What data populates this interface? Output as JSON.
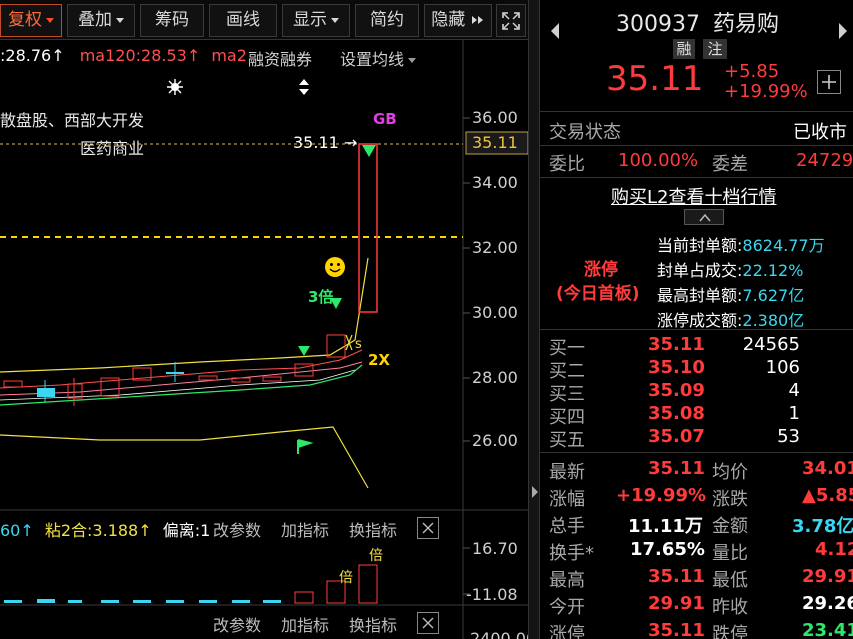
{
  "toolbar": {
    "fuquan": "复权",
    "diejia": "叠加",
    "chouma": "筹码",
    "huaxian": "画线",
    "xianshi": "显示",
    "jianyue": "简约",
    "yincang": "隐藏"
  },
  "chart": {
    "ma_partial": ":28.76",
    "ma120": "ma120:28.53",
    "ma2_partial": "ma2",
    "rongzi": "融资融券",
    "set_ma": "设置均线",
    "concept1": "散盘股、西部大开发",
    "concept2": "医药商业",
    "last_price_label": "35.11",
    "gb_label": "GB",
    "bei3": "3倍",
    "two_x": "2X",
    "y_ticks": [
      "36.00",
      "34.00",
      "32.00",
      "30.00",
      "28.00",
      "26.00"
    ],
    "current_price_tag": "35.11",
    "indicator_bar": {
      "left_partial": "60",
      "nian2": "粘2合:3.188",
      "pianli": "偏离:1",
      "gaicanshu": "改参数",
      "jiazhibiao": "加指标",
      "huanzhibiao": "换指标"
    },
    "sub_y_ticks": [
      "16.70",
      "-11.08"
    ],
    "sub_label": "倍",
    "bottom_bar": {
      "gaicanshu": "改参数",
      "jiazhibiao": "加指标",
      "huanzhibiao": "换指标",
      "bottom_tick_partial": "2400.00"
    },
    "colors": {
      "up": "#ff3b3b",
      "down": "#3bd6f0",
      "ma_yellow": "#f0e040",
      "ma_green": "#2ee86a",
      "ma_red": "#ff5050"
    }
  },
  "quote": {
    "code": "300937",
    "name": "药易购",
    "tag_rong": "融",
    "tag_zhu": "注",
    "price": "35.11",
    "change": "+5.85",
    "change_pct": "+19.99%",
    "status_label": "交易状态",
    "status_value": "已收市",
    "weibi_label": "委比",
    "weibi_value": "100.00%",
    "weicha_label": "委差",
    "weicha_value": "24729",
    "l2_link": "购买L2查看十档行情",
    "limit_title": "涨停",
    "limit_sub": "(今日首板)",
    "limit_rows": [
      {
        "label": "当前封单额:",
        "value": "8624.77万"
      },
      {
        "label": "封单占成交:",
        "value": "22.12%"
      },
      {
        "label": "最高封单额:",
        "value": "7.627亿"
      },
      {
        "label": "涨停成交额:",
        "value": "2.380亿"
      }
    ],
    "bids": [
      {
        "label": "买一",
        "price": "35.11",
        "vol": "24565"
      },
      {
        "label": "买二",
        "price": "35.10",
        "vol": "106"
      },
      {
        "label": "买三",
        "price": "35.09",
        "vol": "4"
      },
      {
        "label": "买四",
        "price": "35.08",
        "vol": "1"
      },
      {
        "label": "买五",
        "price": "35.07",
        "vol": "53"
      }
    ],
    "stats": [
      {
        "l1": "最新",
        "v1": "35.11",
        "l2": "均价",
        "v2": "34.01"
      },
      {
        "l1": "涨幅",
        "v1": "+19.99%",
        "l2": "涨跌",
        "v2": "▲5.85"
      },
      {
        "l1": "总手",
        "v1": "11.11万",
        "l2": "金额",
        "v2": "3.78亿"
      },
      {
        "l1": "换手*",
        "v1": "17.65%",
        "l2": "量比",
        "v2": "4.12"
      },
      {
        "l1": "最高",
        "v1": "35.11",
        "l2": "最低",
        "v2": "29.91"
      },
      {
        "l1": "今开",
        "v1": "29.91",
        "l2": "昨收",
        "v2": "29.26"
      },
      {
        "l1": "涨停",
        "v1": "35.11",
        "l2": "跌停",
        "v2": "23.41"
      }
    ]
  }
}
